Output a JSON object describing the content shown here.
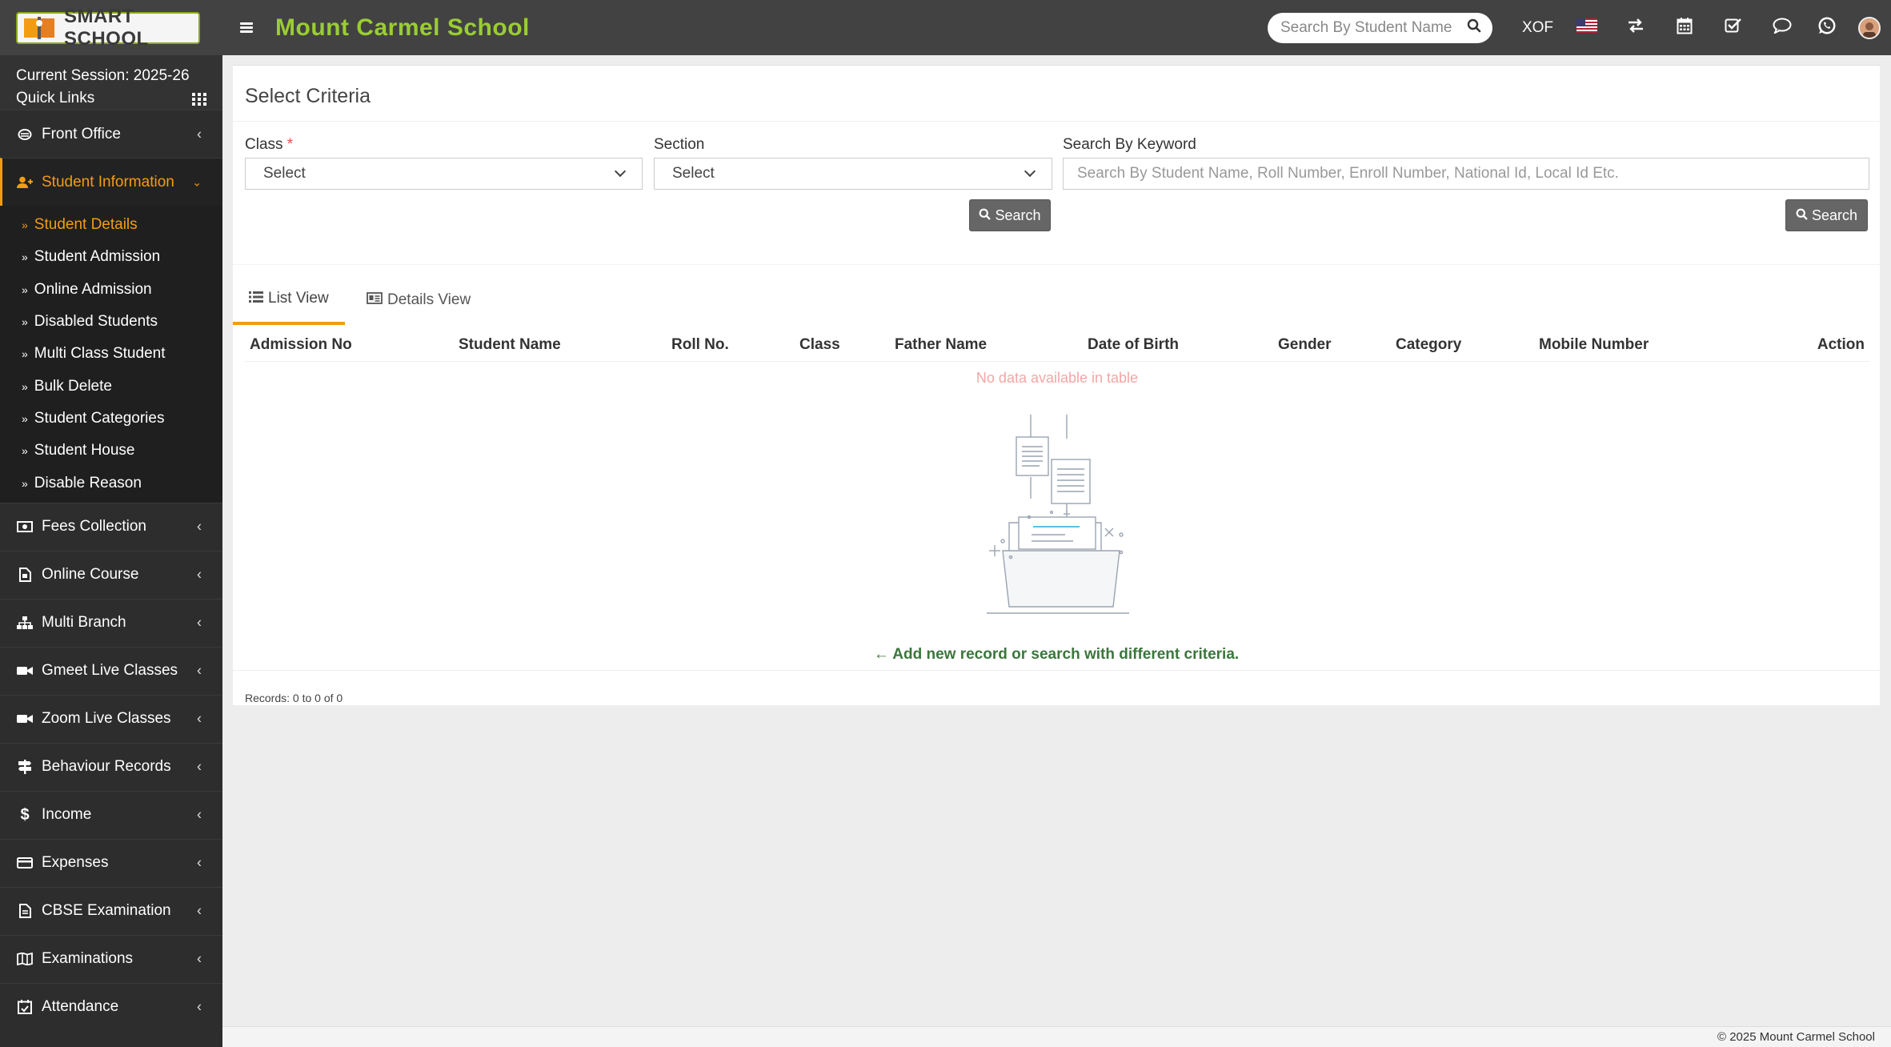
{
  "header": {
    "logo_text": "SMART SCHOOL",
    "school_name": "Mount Carmel School",
    "search_placeholder": "Search By Student Name",
    "currency": "XOF",
    "icons": [
      "search-icon",
      "us-flag-icon",
      "exchange-icon",
      "calendar-icon",
      "task-check-icon",
      "chat-icon",
      "whatsapp-icon",
      "user-avatar"
    ]
  },
  "sidebar": {
    "session_label": "Current Session: 2025-26",
    "quick_links": "Quick Links",
    "items": [
      {
        "label": "Front Office",
        "icon": "front-office-icon"
      },
      {
        "label": "Student Information",
        "icon": "user-plus-icon",
        "active": true
      },
      {
        "label": "Fees Collection",
        "icon": "money-icon"
      },
      {
        "label": "Online Course",
        "icon": "course-icon"
      },
      {
        "label": "Multi Branch",
        "icon": "sitemap-icon"
      },
      {
        "label": "Gmeet Live Classes",
        "icon": "video-icon"
      },
      {
        "label": "Zoom Live Classes",
        "icon": "video-icon"
      },
      {
        "label": "Behaviour Records",
        "icon": "signpost-icon"
      },
      {
        "label": "Income",
        "icon": "dollar-icon"
      },
      {
        "label": "Expenses",
        "icon": "credit-card-icon"
      },
      {
        "label": "CBSE Examination",
        "icon": "file-icon"
      },
      {
        "label": "Examinations",
        "icon": "map-icon"
      },
      {
        "label": "Attendance",
        "icon": "calendar-check-icon"
      }
    ],
    "sub_items": [
      {
        "label": "Student Details",
        "current": true
      },
      {
        "label": "Student Admission"
      },
      {
        "label": "Online Admission"
      },
      {
        "label": "Disabled Students"
      },
      {
        "label": "Multi Class Student"
      },
      {
        "label": "Bulk Delete"
      },
      {
        "label": "Student Categories"
      },
      {
        "label": "Student House"
      },
      {
        "label": "Disable Reason"
      }
    ]
  },
  "criteria": {
    "title": "Select Criteria",
    "class_label": "Class",
    "required_mark": "*",
    "class_value": "Select",
    "section_label": "Section",
    "section_value": "Select",
    "keyword_label": "Search By Keyword",
    "keyword_placeholder": "Search By Student Name, Roll Number, Enroll Number, National Id, Local Id Etc.",
    "search_button": "Search",
    "search_button_2": "Search"
  },
  "tabs": [
    {
      "label": "List View",
      "active": true
    },
    {
      "label": "Details View"
    }
  ],
  "table": {
    "columns": [
      "Admission No",
      "Student Name",
      "Roll No.",
      "Class",
      "Father Name",
      "Date of Birth",
      "Gender",
      "Category",
      "Mobile Number",
      "Action"
    ],
    "empty_text": "No data available in table",
    "empty_message": "Add new record or search with different criteria.",
    "records": "Records: 0 to 0 of 0"
  },
  "footer": {
    "copyright": "© 2025 Mount Carmel School"
  },
  "colors": {
    "header_bg": "#424242",
    "sidebar_bg": "#2d2d2d",
    "accent_orange": "#f39c12",
    "school_name_green": "#9acd32",
    "empty_message_green": "#3c763d"
  }
}
